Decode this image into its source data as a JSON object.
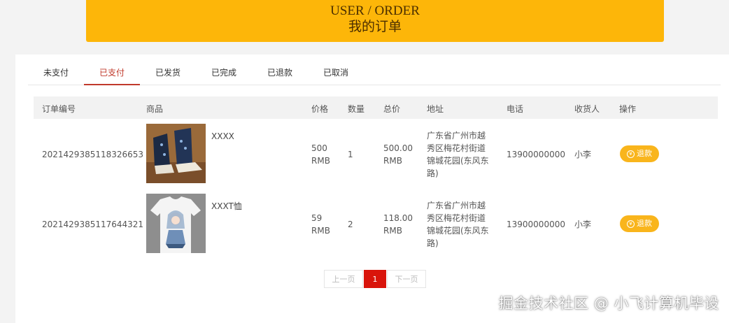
{
  "banner": {
    "title_en": "USER / ORDER",
    "title_cn": "我的订单"
  },
  "tabs": [
    "未支付",
    "已支付",
    "已发货",
    "已完成",
    "已退款",
    "已取消"
  ],
  "active_tab": "已支付",
  "table": {
    "headers": {
      "order_no": "订单编号",
      "product": "商品",
      "price": "价格",
      "qty": "数量",
      "total": "总价",
      "address": "地址",
      "phone": "电话",
      "receiver": "收货人",
      "action": "操作"
    },
    "rows": [
      {
        "order_no": "2021429385118326653",
        "product_name": "XXXX",
        "image": "sneaker-image",
        "price": "500",
        "price_unit": "RMB",
        "qty": "1",
        "total": "500.00",
        "total_unit": "RMB",
        "address": [
          "广东省广州市越",
          "秀区梅花村街道",
          "锦城花园(东风东",
          "路)"
        ],
        "phone": "13900000000",
        "receiver": "小李",
        "action": "退款"
      },
      {
        "order_no": "2021429385117644321",
        "product_name": "XXXT恤",
        "image": "tshirt-image",
        "price": "59",
        "price_unit": "RMB",
        "qty": "2",
        "total": "118.00",
        "total_unit": "RMB",
        "address": [
          "广东省广州市越",
          "秀区梅花村街道",
          "锦城花园(东风东",
          "路)"
        ],
        "phone": "13900000000",
        "receiver": "小李",
        "action": "退款"
      }
    ]
  },
  "pager": {
    "prev": "上一页",
    "current": "1",
    "next": "下一页"
  },
  "watermark": "掘金技术社区 @ 小飞计算机毕设",
  "colors": {
    "banner": "#fdb609",
    "accent": "#c0392b",
    "refund_button": "#f9b51c",
    "page_current": "#d9140b"
  }
}
